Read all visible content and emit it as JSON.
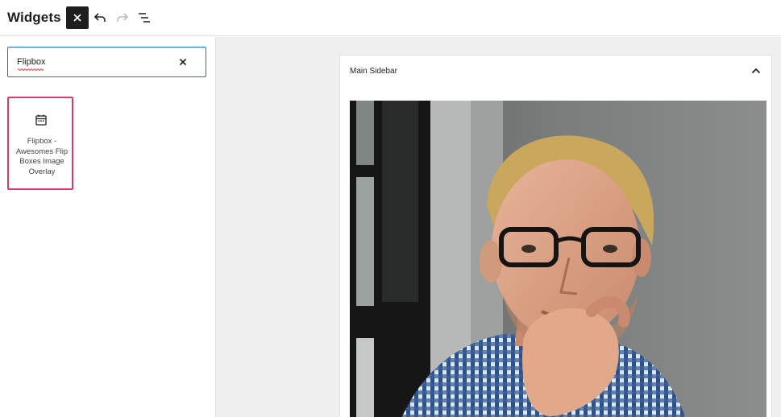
{
  "header": {
    "title": "Widgets",
    "close_icon": "close-icon",
    "undo_icon": "undo-icon",
    "redo_icon": "redo-icon",
    "list_view_icon": "list-view-icon"
  },
  "inserter": {
    "search": {
      "value": "Flipbox",
      "clear_icon": "close-icon"
    },
    "results": [
      {
        "icon": "calendar-icon",
        "label": "Flipbox - Awesomes Flip Boxes Image Overlay"
      }
    ]
  },
  "canvas": {
    "widget_area": {
      "title": "Main Sidebar",
      "toggle_icon": "chevron-up-icon",
      "image": "photo of a blond man with glasses and a checked shirt, hand on chin"
    }
  },
  "colors": {
    "accent": "#2271b1",
    "selection": "#d63b6c",
    "canvas_bg": "#f0f0f1",
    "dark": "#1e1e1e"
  }
}
